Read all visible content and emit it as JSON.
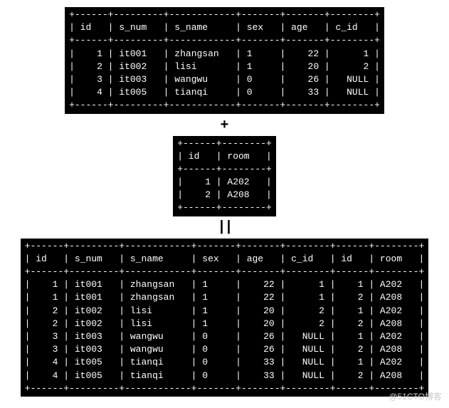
{
  "table1": {
    "headers": [
      "id",
      "s_num",
      "s_name",
      "sex",
      "age",
      "c_id"
    ],
    "rows": [
      {
        "id": "1",
        "s_num": "it001",
        "s_name": "zhangsan",
        "sex": "1",
        "age": "22",
        "c_id": "1"
      },
      {
        "id": "2",
        "s_num": "it002",
        "s_name": "lisi",
        "sex": "1",
        "age": "20",
        "c_id": "2"
      },
      {
        "id": "3",
        "s_num": "it003",
        "s_name": "wangwu",
        "sex": "0",
        "age": "26",
        "c_id": "NULL"
      },
      {
        "id": "4",
        "s_num": "it005",
        "s_name": "tianqi",
        "sex": "0",
        "age": "33",
        "c_id": "NULL"
      }
    ]
  },
  "operator_plus": "+",
  "table2": {
    "headers": [
      "id",
      "room"
    ],
    "rows": [
      {
        "id": "1",
        "room": "A202"
      },
      {
        "id": "2",
        "room": "A208"
      }
    ]
  },
  "operator_eq": "||",
  "table3": {
    "headers": [
      "id",
      "s_num",
      "s_name",
      "sex",
      "age",
      "c_id",
      "id",
      "room"
    ],
    "rows": [
      {
        "id": "1",
        "s_num": "it001",
        "s_name": "zhangsan",
        "sex": "1",
        "age": "22",
        "c_id": "1",
        "id2": "1",
        "room": "A202"
      },
      {
        "id": "1",
        "s_num": "it001",
        "s_name": "zhangsan",
        "sex": "1",
        "age": "22",
        "c_id": "1",
        "id2": "2",
        "room": "A208"
      },
      {
        "id": "2",
        "s_num": "it002",
        "s_name": "lisi",
        "sex": "1",
        "age": "20",
        "c_id": "2",
        "id2": "1",
        "room": "A202"
      },
      {
        "id": "2",
        "s_num": "it002",
        "s_name": "lisi",
        "sex": "1",
        "age": "20",
        "c_id": "2",
        "id2": "2",
        "room": "A208"
      },
      {
        "id": "3",
        "s_num": "it003",
        "s_name": "wangwu",
        "sex": "0",
        "age": "26",
        "c_id": "NULL",
        "id2": "1",
        "room": "A202"
      },
      {
        "id": "3",
        "s_num": "it003",
        "s_name": "wangwu",
        "sex": "0",
        "age": "26",
        "c_id": "NULL",
        "id2": "2",
        "room": "A208"
      },
      {
        "id": "4",
        "s_num": "it005",
        "s_name": "tianqi",
        "sex": "0",
        "age": "33",
        "c_id": "NULL",
        "id2": "1",
        "room": "A202"
      },
      {
        "id": "4",
        "s_num": "it005",
        "s_name": "tianqi",
        "sex": "0",
        "age": "33",
        "c_id": "NULL",
        "id2": "2",
        "room": "A208"
      }
    ]
  },
  "watermark": "@51CTO博客"
}
